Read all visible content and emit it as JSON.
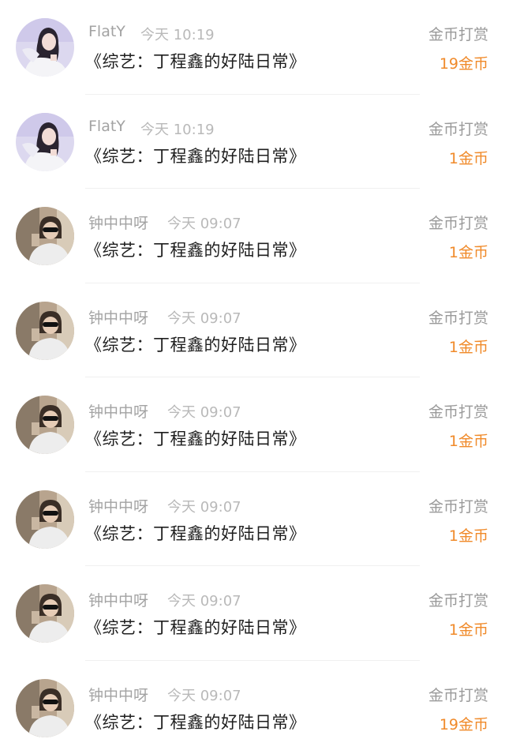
{
  "rows": [
    {
      "user": "FlatY",
      "time": "今天 10:19",
      "title": "《综艺：丁程鑫的好陆日常》",
      "type": "金币打赏",
      "amount": "19金币",
      "avatar": "avatar-girl-icon"
    },
    {
      "user": "FlatY",
      "time": "今天 10:19",
      "title": "《综艺：丁程鑫的好陆日常》",
      "type": "金币打赏",
      "amount": "1金币",
      "avatar": "avatar-girl-icon"
    },
    {
      "user": "钟中中呀",
      "time": "今天 09:07",
      "title": "《综艺：丁程鑫的好陆日常》",
      "type": "金币打赏",
      "amount": "1金币",
      "avatar": "avatar-sunglasses-icon"
    },
    {
      "user": "钟中中呀",
      "time": "今天 09:07",
      "title": "《综艺：丁程鑫的好陆日常》",
      "type": "金币打赏",
      "amount": "1金币",
      "avatar": "avatar-sunglasses-icon"
    },
    {
      "user": "钟中中呀",
      "time": "今天 09:07",
      "title": "《综艺：丁程鑫的好陆日常》",
      "type": "金币打赏",
      "amount": "1金币",
      "avatar": "avatar-sunglasses-icon"
    },
    {
      "user": "钟中中呀",
      "time": "今天 09:07",
      "title": "《综艺：丁程鑫的好陆日常》",
      "type": "金币打赏",
      "amount": "1金币",
      "avatar": "avatar-sunglasses-icon"
    },
    {
      "user": "钟中中呀",
      "time": "今天 09:07",
      "title": "《综艺：丁程鑫的好陆日常》",
      "type": "金币打赏",
      "amount": "1金币",
      "avatar": "avatar-sunglasses-icon"
    },
    {
      "user": "钟中中呀",
      "time": "今天 09:07",
      "title": "《综艺：丁程鑫的好陆日常》",
      "type": "金币打赏",
      "amount": "19金币",
      "avatar": "avatar-sunglasses-icon"
    }
  ],
  "colors": {
    "amount": "#f08a2a",
    "username": "#a3a3a3",
    "title": "#1f1f1f"
  }
}
